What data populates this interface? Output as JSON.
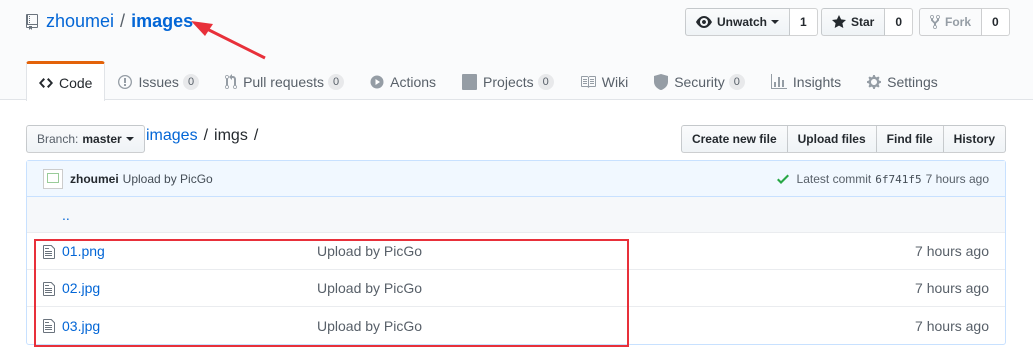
{
  "repo": {
    "owner": "zhoumei",
    "separator": "/",
    "name": "images"
  },
  "actions": {
    "watch_label": "Unwatch",
    "watch_count": "1",
    "star_label": "Star",
    "star_count": "0",
    "fork_label": "Fork",
    "fork_count": "0"
  },
  "nav": {
    "code": "Code",
    "issues": "Issues",
    "issues_count": "0",
    "pulls": "Pull requests",
    "pulls_count": "0",
    "actions": "Actions",
    "projects": "Projects",
    "projects_count": "0",
    "wiki": "Wiki",
    "security": "Security",
    "security_count": "0",
    "insights": "Insights",
    "settings": "Settings"
  },
  "branch": {
    "label": "Branch:",
    "value": "master"
  },
  "breadcrumb": {
    "repo": "images",
    "sep": "/",
    "folder": "imgs",
    "trailing": "/"
  },
  "file_buttons": {
    "create": "Create new file",
    "upload": "Upload files",
    "find": "Find file",
    "history": "History"
  },
  "commit": {
    "author": "zhoumei",
    "message": "Upload by PicGo",
    "latest_label": "Latest commit",
    "sha": "6f741f5",
    "age": "7 hours ago"
  },
  "up_dir": "..",
  "files": [
    {
      "name": "01.png",
      "message": "Upload by PicGo",
      "age": "7 hours ago"
    },
    {
      "name": "02.jpg",
      "message": "Upload by PicGo",
      "age": "7 hours ago"
    },
    {
      "name": "03.jpg",
      "message": "Upload by PicGo",
      "age": "7 hours ago"
    }
  ],
  "colors": {
    "link": "#0366d6",
    "tab_accent": "#e36209",
    "annotation": "#e8303a",
    "check": "#28a745"
  }
}
